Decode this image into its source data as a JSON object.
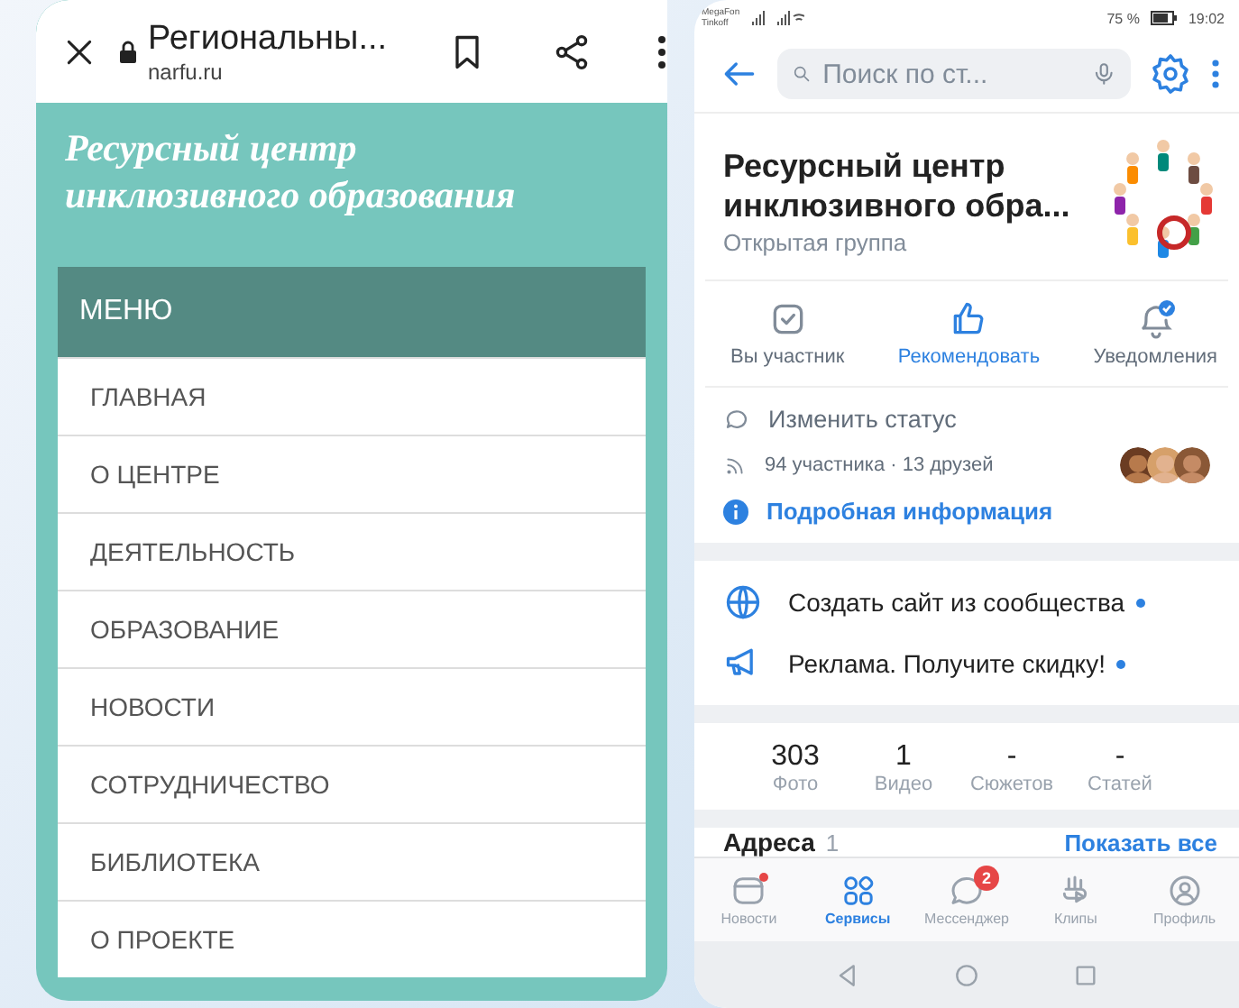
{
  "browser": {
    "title": "Региональны...",
    "url": "narfu.ru"
  },
  "site": {
    "title": "Ресурсный центр инклюзивного образования",
    "menu_title": "МЕНЮ",
    "menu": [
      "ГЛАВНАЯ",
      "О ЦЕНТРЕ",
      "ДЕЯТЕЛЬНОСТЬ",
      "ОБРАЗОВАНИЕ",
      "НОВОСТИ",
      "СОТРУДНИЧЕСТВО",
      "БИБЛИОТЕКА",
      "О ПРОЕКТЕ"
    ]
  },
  "status_bar": {
    "carrier_1": "MegaFon",
    "carrier_2": "Tinkoff",
    "battery": "75 %",
    "time": "19:02"
  },
  "search": {
    "placeholder": "Поиск по ст..."
  },
  "group": {
    "name": "Ресурсный центр инклюзивного обра...",
    "type": "Открытая группа"
  },
  "actions": [
    {
      "label": "Вы участник",
      "kind": "member",
      "accent": false
    },
    {
      "label": "Рекомендовать",
      "kind": "like",
      "accent": true
    },
    {
      "label": "Уведомления",
      "kind": "bell",
      "accent": false
    }
  ],
  "info": {
    "status": "Изменить статус",
    "members": "94 участника · 13 друзей",
    "details": "Подробная информация"
  },
  "promos": [
    {
      "label": "Создать сайт из сообщества",
      "kind": "globe",
      "new": true
    },
    {
      "label": "Реклама. Получите скидку!",
      "kind": "megaphone",
      "new": true
    }
  ],
  "counters": [
    {
      "value": "303",
      "label": "Фото"
    },
    {
      "value": "1",
      "label": "Видео"
    },
    {
      "value": "-",
      "label": "Сюжетов"
    },
    {
      "value": "-",
      "label": "Статей"
    }
  ],
  "addresses": {
    "title": "Адреса",
    "count": "1",
    "link": "Показать все"
  },
  "tabs": [
    {
      "label": "Новости",
      "kind": "news",
      "selected": false,
      "dot": true
    },
    {
      "label": "Сервисы",
      "kind": "services",
      "selected": true,
      "dot": false
    },
    {
      "label": "Мессенджер",
      "kind": "messenger",
      "selected": false,
      "dot": false,
      "badge": "2"
    },
    {
      "label": "Клипы",
      "kind": "clips",
      "selected": false,
      "dot": false
    },
    {
      "label": "Профиль",
      "kind": "profile",
      "selected": false,
      "dot": false
    }
  ]
}
